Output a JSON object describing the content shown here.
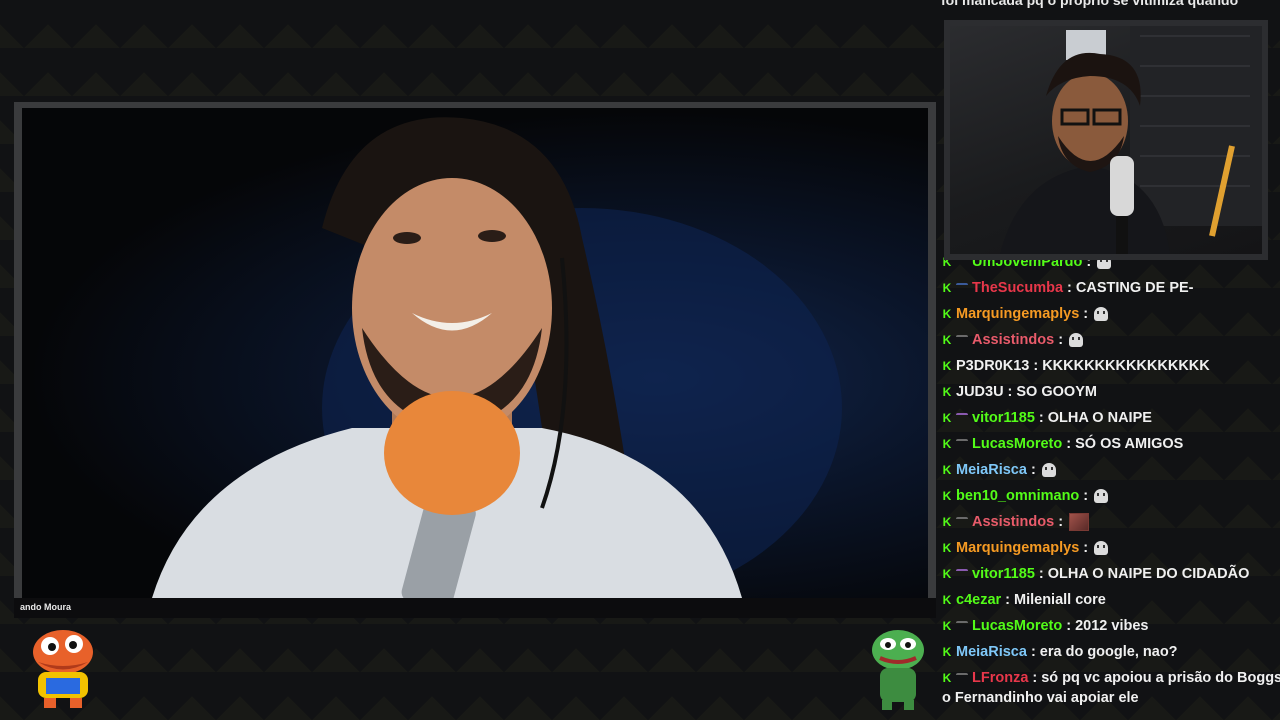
{
  "stream": {
    "guest_caption": "ando Moura"
  },
  "chat": {
    "top_partial": "foi mancada pq o proprio se vitimiza quando",
    "messages": [
      {
        "user": "UmJovemPardo",
        "text": "",
        "color": "#53fc18",
        "emote": "ghost",
        "badge": "sub"
      },
      {
        "user": "TheSucumba",
        "text": "CASTING DE PE-",
        "color": "#e8374a",
        "emote": "",
        "badge": "sub-blue"
      },
      {
        "user": "Marquingemaplys",
        "text": "",
        "color": "#f59a23",
        "emote": "ghost",
        "badge": ""
      },
      {
        "user": "Assistindos",
        "text": "",
        "color": "#e85b6a",
        "emote": "ghost",
        "badge": "sub"
      },
      {
        "user": "P3DR0K13",
        "text": "KKKKKKKKKKKKKKKK",
        "color": "#f0f0f0",
        "emote": "",
        "badge": ""
      },
      {
        "user": "JUD3U",
        "text": "SO GOOYM",
        "color": "#f0f0f0",
        "emote": "",
        "badge": ""
      },
      {
        "user": "vitor1185",
        "text": "OLHA O NAIPE",
        "color": "#53fc18",
        "emote": "",
        "badge": "sub-purple"
      },
      {
        "user": "LucasMoreto",
        "text": "SÓ OS AMIGOS",
        "color": "#53fc18",
        "emote": "",
        "badge": "sub"
      },
      {
        "user": "MeiaRisca",
        "text": "",
        "color": "#7fc8f8",
        "emote": "ghost",
        "badge": ""
      },
      {
        "user": "ben10_omnimano",
        "text": "",
        "color": "#53fc18",
        "emote": "ghost",
        "badge": ""
      },
      {
        "user": "Assistindos",
        "text": "",
        "color": "#e85b6a",
        "emote": "image",
        "badge": "sub"
      },
      {
        "user": "Marquingemaplys",
        "text": "",
        "color": "#f59a23",
        "emote": "ghost",
        "badge": ""
      },
      {
        "user": "vitor1185",
        "text": "OLHA O NAIPE DO CIDADÃO",
        "color": "#53fc18",
        "emote": "",
        "badge": "sub-purple"
      },
      {
        "user": "c4ezar",
        "text": "Mileniall core",
        "color": "#53fc18",
        "emote": "",
        "badge": ""
      },
      {
        "user": "LucasMoreto",
        "text": "2012 vibes",
        "color": "#53fc18",
        "emote": "",
        "badge": "sub"
      },
      {
        "user": "MeiaRisca",
        "text": "era do google, nao?",
        "color": "#7fc8f8",
        "emote": "",
        "badge": ""
      },
      {
        "user": "LFronza",
        "text": "só pq vc apoiou a prisão do Boggs",
        "color": "#e8374a",
        "emote": "",
        "badge": "sub"
      }
    ],
    "wrap_continuation": "o Fernandinho vai apoiar ele",
    "separator": ":",
    "kick_badge": "K"
  }
}
